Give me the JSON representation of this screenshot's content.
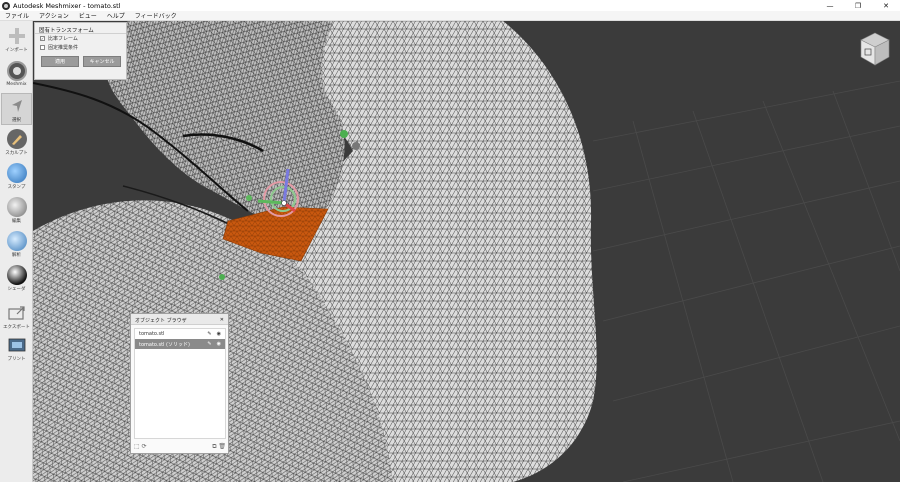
{
  "window": {
    "title": "Autodesk Meshmixer - tomato.stl",
    "minimize_glyph": "—",
    "restore_glyph": "❐",
    "close_glyph": "✕"
  },
  "menu": [
    "ファイル",
    "アクション",
    "ビュー",
    "ヘルプ",
    "フィードバック"
  ],
  "toolbar": [
    {
      "id": "import",
      "label": "インポート",
      "icon": "plus-icon"
    },
    {
      "id": "meshmix",
      "label": "Meshmix",
      "icon": "meshmix-icon"
    },
    {
      "id": "select",
      "label": "選択",
      "icon": "select-arrow-icon"
    },
    {
      "id": "sculpt",
      "label": "スカルプト",
      "icon": "brush-icon"
    },
    {
      "id": "stamp",
      "label": "スタンプ",
      "icon": "stamp-icon"
    },
    {
      "id": "edit",
      "label": "編集",
      "icon": "edit-sphere-icon"
    },
    {
      "id": "analysis",
      "label": "解析",
      "icon": "analysis-sphere-icon"
    },
    {
      "id": "shaders",
      "label": "シェーダ",
      "icon": "shader-sphere-icon"
    },
    {
      "id": "export",
      "label": "エクスポート",
      "icon": "export-icon"
    },
    {
      "id": "print",
      "label": "プリント",
      "icon": "print-icon"
    }
  ],
  "transform_panel": {
    "title": "固有トランスフォーム",
    "option1": "比率フレーム",
    "option1_checked": true,
    "option2": "固定推奨条件",
    "option2_checked": false,
    "apply_label": "適用",
    "cancel_label": "キャンセル"
  },
  "object_browser": {
    "title": "オブジェクト ブラウザ",
    "items": [
      {
        "name": "tomato.stl",
        "selected": false
      },
      {
        "name": "tomato.stl (ソリッド)",
        "selected": true
      }
    ]
  },
  "colors": {
    "viewport_bg": "#3b3b3b",
    "mesh_fill": "#d9d9d9",
    "mesh_lines": "#2a2a2a",
    "selection": "#c85a10",
    "toolbar_bg": "#ececec"
  }
}
